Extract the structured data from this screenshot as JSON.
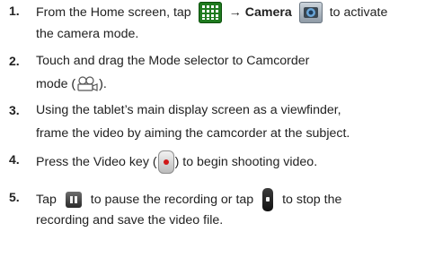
{
  "steps": [
    {
      "number": "1.",
      "line1": {
        "pre": "From the Home screen, tap",
        "arrow": "→",
        "camera_label": "Camera",
        "post": "to activate"
      },
      "line2": "the camera mode."
    },
    {
      "number": "2.",
      "line1": "Touch and drag the Mode selector  to Camcorder",
      "line2": {
        "pre": "mode (",
        "post": ")."
      }
    },
    {
      "number": "3.",
      "line1": "Using the tablet’s main display screen as a viewfinder,",
      "line2": "frame the video by aiming the camcorder at the subject."
    },
    {
      "number": "4.",
      "line1": {
        "pre": "Press the Video key (",
        "post": ") to begin shooting video."
      }
    },
    {
      "number": "5.",
      "line1": {
        "pre": "Tap",
        "mid": "to pause the recording or tap",
        "post": "to stop the"
      },
      "line2": "recording and save the video file."
    }
  ],
  "icons": {
    "apps": "apps-grid-icon",
    "camera": "camera-app-icon",
    "camcorder": "camcorder-icon",
    "video_key": "video-key-icon",
    "pause": "pause-icon",
    "stop": "stop-icon"
  },
  "colors": {
    "text": "#222222",
    "apps_icon_green": "#1f7a1f",
    "record_red": "#d01818"
  }
}
